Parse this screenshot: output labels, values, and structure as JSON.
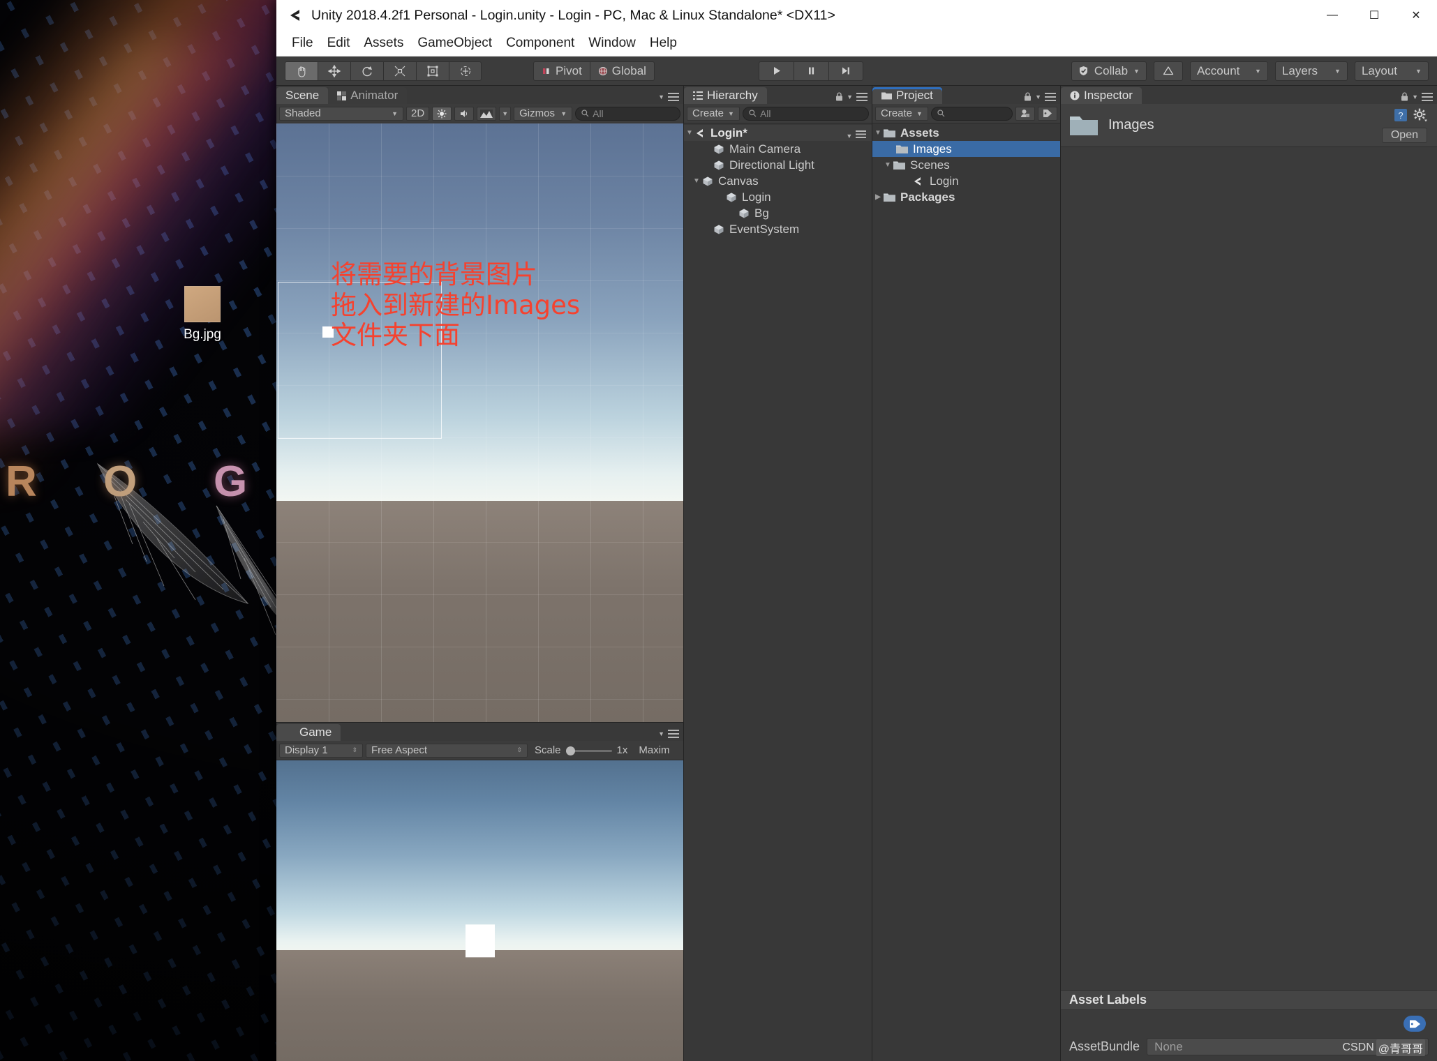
{
  "window": {
    "title": "Unity 2018.4.2f1 Personal - Login.unity - Login - PC, Mac & Linux Standalone* <DX11>",
    "minimize_label": "—",
    "maximize_label": "☐",
    "close_label": "✕"
  },
  "menubar": {
    "items": [
      "File",
      "Edit",
      "Assets",
      "GameObject",
      "Component",
      "Window",
      "Help"
    ]
  },
  "toolbar": {
    "tools": [
      {
        "name": "hand-tool",
        "glyph": "✋",
        "active": true
      },
      {
        "name": "move-tool",
        "glyph": "✥",
        "active": false
      },
      {
        "name": "rotate-tool",
        "glyph": "↻",
        "active": false
      },
      {
        "name": "scale-tool",
        "glyph": "⤢",
        "active": false
      },
      {
        "name": "rect-tool",
        "glyph": "□",
        "active": false
      },
      {
        "name": "transform-tool",
        "glyph": "✶",
        "active": false
      }
    ],
    "pivot_label": "Pivot",
    "global_label": "Global",
    "play_label": "▶",
    "pause_label": "‖",
    "step_label": "▶|",
    "collab_label": "Collab",
    "cloud_label": "☁",
    "account_label": "Account",
    "layers_label": "Layers",
    "layout_label": "Layout"
  },
  "scene_panel": {
    "tabs": [
      {
        "label": "Scene",
        "icon": "scene-icon",
        "active": true
      },
      {
        "label": "Animator",
        "icon": "animator-icon",
        "active": false
      }
    ],
    "draw_mode": "Shaded",
    "mode_2d": "2D",
    "lighting_icon": "sun-icon",
    "audio_icon": "audio-icon",
    "fx_icon": "fx-icon",
    "gizmos_label": "Gizmos",
    "search_placeholder": "All"
  },
  "annotation": {
    "line1": "将需要的背景图片",
    "line2": "拖入到新建的Images",
    "line3": "文件夹下面",
    "color": "#f5422f",
    "arrow_color": "#f23a2b"
  },
  "game_panel": {
    "tab_label": "Game",
    "display_label": "Display 1",
    "aspect_label": "Free Aspect",
    "scale_label": "Scale",
    "scale_value": "1x",
    "maximize_label": "Maxim"
  },
  "hierarchy": {
    "tab_label": "Hierarchy",
    "create_label": "Create",
    "search_placeholder": "All",
    "scene_name": "Login*",
    "items": [
      {
        "label": "Main Camera",
        "depth": 1,
        "expandable": false
      },
      {
        "label": "Directional Light",
        "depth": 1,
        "expandable": false
      },
      {
        "label": "Canvas",
        "depth": 1,
        "expandable": true
      },
      {
        "label": "Login",
        "depth": 2,
        "expandable": false
      },
      {
        "label": "Bg",
        "depth": 3,
        "expandable": false
      },
      {
        "label": "EventSystem",
        "depth": 1,
        "expandable": false
      }
    ]
  },
  "project": {
    "tab_label": "Project",
    "create_label": "Create",
    "search_placeholder": "",
    "items": [
      {
        "label": "Assets",
        "depth": 0,
        "expandable": true,
        "expanded": true,
        "icon": "folder-icon",
        "bold": true,
        "selected": false
      },
      {
        "label": "Images",
        "depth": 1,
        "expandable": false,
        "expanded": false,
        "icon": "folder-icon",
        "bold": false,
        "selected": true
      },
      {
        "label": "Scenes",
        "depth": 1,
        "expandable": true,
        "expanded": true,
        "icon": "folder-icon",
        "bold": false,
        "selected": false
      },
      {
        "label": "Login",
        "depth": 2,
        "expandable": false,
        "expanded": false,
        "icon": "unity-icon",
        "bold": false,
        "selected": false
      },
      {
        "label": "Packages",
        "depth": 0,
        "expandable": true,
        "expanded": false,
        "icon": "folder-icon",
        "bold": true,
        "selected": false
      }
    ]
  },
  "inspector": {
    "tab_label": "Inspector",
    "asset_name": "Images",
    "open_label": "Open",
    "help_icon": "help-icon",
    "gear_icon": "gear-icon",
    "asset_labels_header": "Asset Labels",
    "assetbundle_label": "AssetBundle",
    "assetbundle_value": "None",
    "watermark": "CSDN",
    "watermark_cn": "@青哥哥"
  },
  "desktop": {
    "icon_label": "Bg.jpg",
    "wallpaper_letters": [
      "R",
      "O",
      "G"
    ]
  },
  "colors": {
    "selection_blue": "#3a6ba5",
    "accent_red": "#f23a2b",
    "panel_bg": "#383838",
    "toolbar_bg": "#3c3c3c"
  }
}
